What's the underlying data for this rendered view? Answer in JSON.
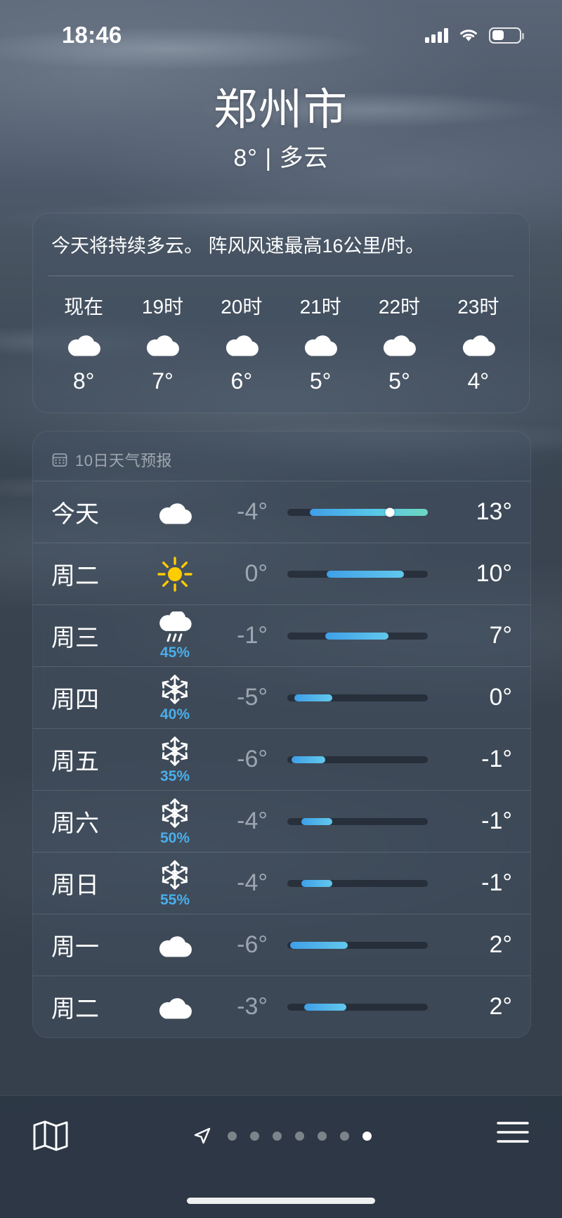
{
  "status_bar": {
    "time": "18:46",
    "signal_icon": "cellular-bars-icon",
    "wifi_icon": "wifi-icon",
    "battery_icon": "battery-icon"
  },
  "header": {
    "city": "郑州市",
    "condition_line": "8° | 多云"
  },
  "hourly": {
    "summary": "今天将持续多云。 阵风风速最高16公里/时。",
    "items": [
      {
        "label": "现在",
        "icon": "cloud-icon",
        "temp": "8°"
      },
      {
        "label": "19时",
        "icon": "cloud-icon",
        "temp": "7°"
      },
      {
        "label": "20时",
        "icon": "cloud-icon",
        "temp": "6°"
      },
      {
        "label": "21时",
        "icon": "cloud-icon",
        "temp": "5°"
      },
      {
        "label": "22时",
        "icon": "cloud-icon",
        "temp": "5°"
      },
      {
        "label": "23时",
        "icon": "cloud-icon",
        "temp": "4°"
      }
    ]
  },
  "daily": {
    "title": "10日天气预报",
    "title_icon": "calendar-icon",
    "rows": [
      {
        "day": "今天",
        "icon": "cloud-icon",
        "pop": "",
        "low": "-4°",
        "high": "13°",
        "bar_start": 16,
        "bar_end": 100,
        "dot": 73
      },
      {
        "day": "周二",
        "icon": "sun-icon",
        "pop": "",
        "low": "0°",
        "high": "10°",
        "bar_start": 28,
        "bar_end": 83,
        "dot": null
      },
      {
        "day": "周三",
        "icon": "rain-cloud-icon",
        "pop": "45%",
        "low": "-1°",
        "high": "7°",
        "bar_start": 27,
        "bar_end": 72,
        "dot": null
      },
      {
        "day": "周四",
        "icon": "snowflake-icon",
        "pop": "40%",
        "low": "-5°",
        "high": "0°",
        "bar_start": 5,
        "bar_end": 32,
        "dot": null
      },
      {
        "day": "周五",
        "icon": "snowflake-icon",
        "pop": "35%",
        "low": "-6°",
        "high": "-1°",
        "bar_start": 3,
        "bar_end": 27,
        "dot": null
      },
      {
        "day": "周六",
        "icon": "snowflake-icon",
        "pop": "50%",
        "low": "-4°",
        "high": "-1°",
        "bar_start": 10,
        "bar_end": 32,
        "dot": null
      },
      {
        "day": "周日",
        "icon": "snowflake-icon",
        "pop": "55%",
        "low": "-4°",
        "high": "-1°",
        "bar_start": 10,
        "bar_end": 32,
        "dot": null
      },
      {
        "day": "周一",
        "icon": "cloud-icon",
        "pop": "",
        "low": "-6°",
        "high": "2°",
        "bar_start": 2,
        "bar_end": 43,
        "dot": null
      },
      {
        "day": "周二",
        "icon": "cloud-icon",
        "pop": "",
        "low": "-3°",
        "high": "2°",
        "bar_start": 12,
        "bar_end": 42,
        "dot": null
      }
    ]
  },
  "tabbar": {
    "map_icon": "map-icon",
    "location_icon": "location-arrow-icon",
    "list_icon": "list-icon",
    "pages": 7,
    "active_page": 7
  },
  "colors": {
    "accent_blue": "#4aaeea",
    "bar_cold": "#3f9fe8",
    "bar_warm": "#6fd6c0",
    "text_primary": "#ffffff",
    "text_dim": "rgba(235,240,248,0.55)"
  }
}
